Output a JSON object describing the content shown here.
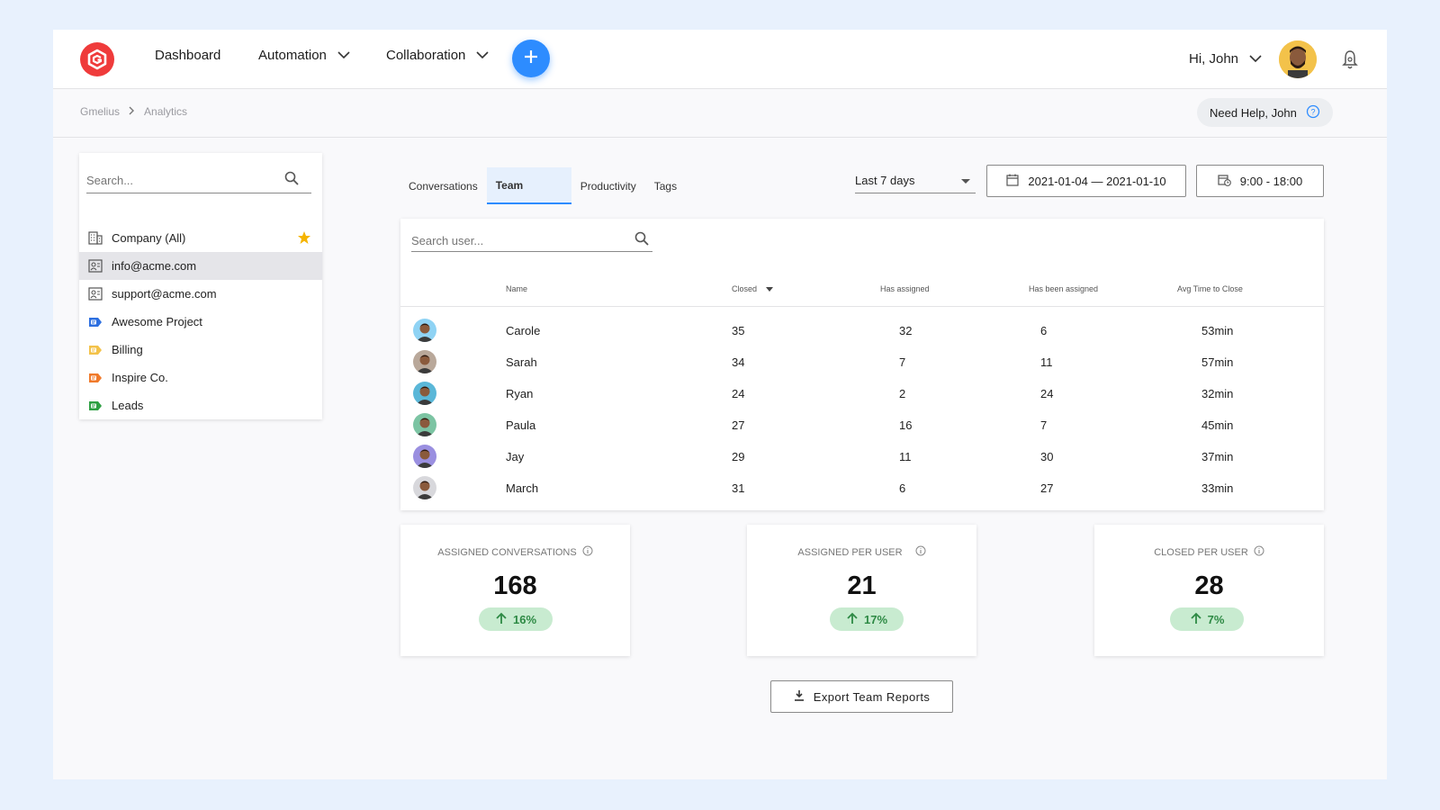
{
  "header": {
    "logo_icon": "gmelius-logo-icon",
    "nav": [
      {
        "label": "Dashboard",
        "has_dropdown": false
      },
      {
        "label": "Automation",
        "has_dropdown": true
      },
      {
        "label": "Collaboration",
        "has_dropdown": true
      }
    ],
    "greeting": "Hi, John",
    "plus_icon": "plus-icon",
    "bell_icon": "notification-bell-icon"
  },
  "breadcrumb": {
    "items": [
      "Gmelius",
      "Analytics"
    ]
  },
  "help": {
    "label": "Need Help, John"
  },
  "left_panel": {
    "search_placeholder": "Search...",
    "items": [
      {
        "label": "Company (All)",
        "icon": "building-icon",
        "icon_color": "#555555",
        "starred": true
      },
      {
        "label": "info@acme.com",
        "icon": "inbox-icon",
        "icon_color": "#555555",
        "active": true
      },
      {
        "label": "support@acme.com",
        "icon": "inbox-icon",
        "icon_color": "#555555"
      },
      {
        "label": "Awesome Project",
        "icon": "project-label-icon",
        "icon_color": "#2d6fe0"
      },
      {
        "label": "Billing",
        "icon": "project-label-icon",
        "icon_color": "#f3c24a"
      },
      {
        "label": "Inspire Co.",
        "icon": "project-label-icon",
        "icon_color": "#f07a2b"
      },
      {
        "label": "Leads",
        "icon": "project-label-icon",
        "icon_color": "#2ea043"
      }
    ]
  },
  "tabs": [
    {
      "label": "Conversations",
      "active": false
    },
    {
      "label": "Team",
      "active": true
    },
    {
      "label": "Productivity",
      "active": false
    },
    {
      "label": "Tags",
      "active": false
    }
  ],
  "filters": {
    "range": "Last 7 days",
    "date_range": "2021-01-04 — 2021-01-10",
    "hours": "9:00 - 18:00"
  },
  "table": {
    "search_placeholder": "Search user...",
    "columns": [
      "Name",
      "Closed",
      "Has assigned",
      "Has been assigned",
      "Avg Time to Close"
    ],
    "sort_column": "Closed",
    "rows": [
      {
        "name": "Carole",
        "closed": "35",
        "has_assigned": "32",
        "been_assigned": "6",
        "avg_time": "53min",
        "avatar_color": "#8fd3f4"
      },
      {
        "name": "Sarah",
        "closed": "34",
        "has_assigned": "7",
        "been_assigned": "11",
        "avg_time": "57min",
        "avatar_color": "#b9a89a"
      },
      {
        "name": "Ryan",
        "closed": "24",
        "has_assigned": "2",
        "been_assigned": "24",
        "avg_time": "32min",
        "avatar_color": "#5ab7d8"
      },
      {
        "name": "Paula",
        "closed": "27",
        "has_assigned": "16",
        "been_assigned": "7",
        "avg_time": "45min",
        "avatar_color": "#7cc4a3"
      },
      {
        "name": "Jay",
        "closed": "29",
        "has_assigned": "11",
        "been_assigned": "30",
        "avg_time": "37min",
        "avatar_color": "#9a8fe0"
      },
      {
        "name": "March",
        "closed": "31",
        "has_assigned": "6",
        "been_assigned": "27",
        "avg_time": "33min",
        "avatar_color": "#d8d8dc"
      }
    ]
  },
  "stats": [
    {
      "label": "ASSIGNED CONVERSATIONS",
      "value": "168",
      "change": "16%"
    },
    {
      "label": "ASSIGNED PER USER",
      "value": "21",
      "change": "17%"
    },
    {
      "label": "CLOSED PER USER",
      "value": "28",
      "change": "7%"
    }
  ],
  "export": {
    "label": "Export Team Reports"
  },
  "colors": {
    "accent": "#2d8cff",
    "brand": "#ef3b3b",
    "positive": "#2e8a45",
    "positive_bg": "#c8ebd0",
    "star": "#f5b400"
  }
}
